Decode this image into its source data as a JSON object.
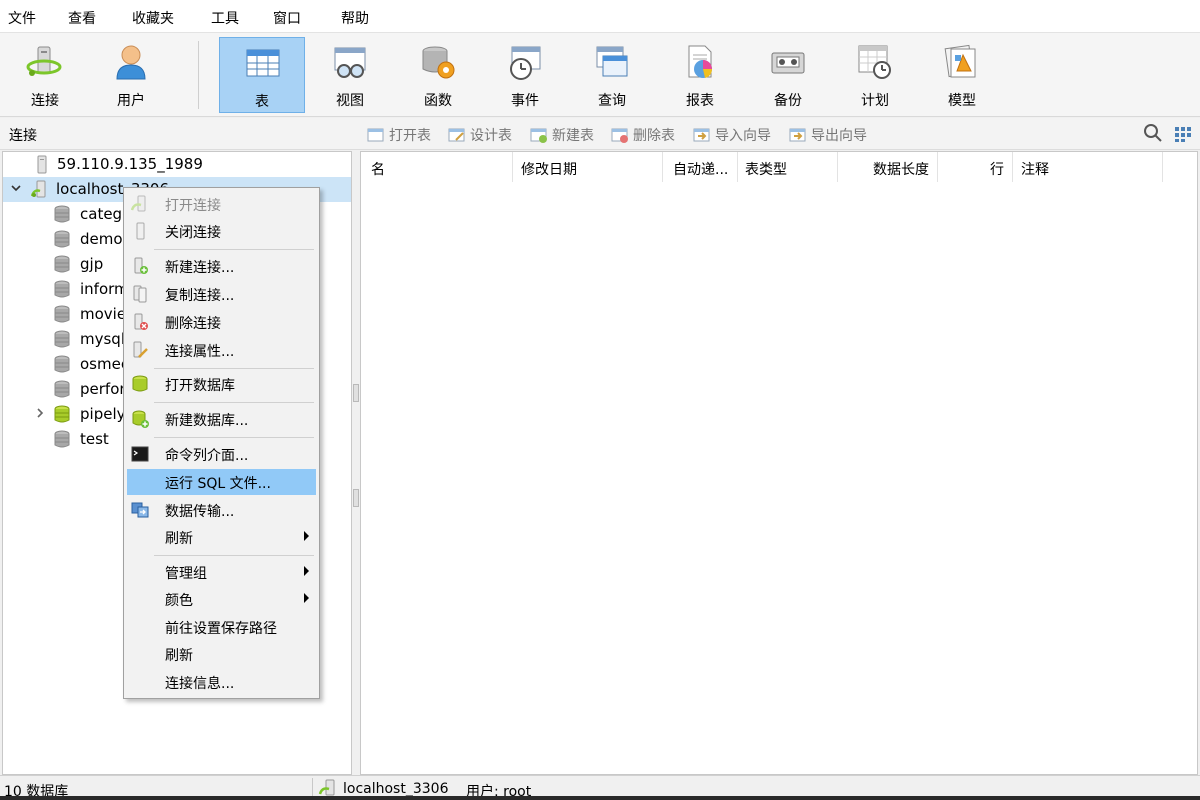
{
  "menubar": {
    "items": [
      "文件",
      "查看",
      "收藏夹",
      "工具",
      "窗口",
      "帮助"
    ]
  },
  "toolbar": {
    "buttons": [
      {
        "label": "连接",
        "icon": "connection-icon"
      },
      {
        "label": "用户",
        "icon": "user-icon"
      },
      {
        "label": "表",
        "icon": "table-icon",
        "active": true
      },
      {
        "label": "视图",
        "icon": "view-icon"
      },
      {
        "label": "函数",
        "icon": "function-icon"
      },
      {
        "label": "事件",
        "icon": "event-icon"
      },
      {
        "label": "查询",
        "icon": "query-icon"
      },
      {
        "label": "报表",
        "icon": "report-icon"
      },
      {
        "label": "备份",
        "icon": "backup-icon"
      },
      {
        "label": "计划",
        "icon": "schedule-icon"
      },
      {
        "label": "模型",
        "icon": "model-icon"
      }
    ]
  },
  "subheader": {
    "title": "连接",
    "object_buttons": [
      "打开表",
      "设计表",
      "新建表",
      "删除表",
      "导入向导",
      "导出向导"
    ]
  },
  "tree": {
    "connections": [
      {
        "label": "59.110.9.135_1989",
        "expanded": false
      },
      {
        "label": "localhost_3306",
        "expanded": true
      }
    ],
    "databases": [
      {
        "label": "catego",
        "open": false
      },
      {
        "label": "demo",
        "open": false
      },
      {
        "label": "gjp",
        "open": false
      },
      {
        "label": "inform",
        "open": false
      },
      {
        "label": "movie",
        "open": false
      },
      {
        "label": "mysql",
        "open": false
      },
      {
        "label": "osmec",
        "open": false
      },
      {
        "label": "perfor",
        "open": false
      },
      {
        "label": "pipely",
        "open": true
      },
      {
        "label": "test",
        "open": false
      }
    ]
  },
  "table_columns": [
    "名",
    "修改日期",
    "自动递...",
    "表类型",
    "数据长度",
    "行",
    "注释"
  ],
  "context_menu": {
    "items": [
      {
        "label": "打开连接",
        "icon": "open-connection-icon",
        "disabled": true
      },
      {
        "label": "关闭连接",
        "icon": "close-connection-icon"
      },
      {
        "label": "新建连接...",
        "icon": "new-connection-icon"
      },
      {
        "label": "复制连接...",
        "icon": "copy-connection-icon"
      },
      {
        "label": "删除连接",
        "icon": "delete-connection-icon"
      },
      {
        "label": "连接属性...",
        "icon": "connection-properties-icon"
      },
      {
        "label": "打开数据库",
        "icon": "open-database-icon"
      },
      {
        "label": "新建数据库...",
        "icon": "new-database-icon"
      },
      {
        "label": "命令列介面...",
        "icon": "console-icon"
      },
      {
        "label": "运行 SQL 文件...",
        "highlighted": true
      },
      {
        "label": "数据传输...",
        "icon": "data-transfer-icon"
      },
      {
        "label": "刷新",
        "submenu": true
      },
      {
        "label": "管理组",
        "submenu": true
      },
      {
        "label": "颜色",
        "submenu": true
      },
      {
        "label": "前往设置保存路径"
      },
      {
        "label": "刷新"
      },
      {
        "label": "连接信息..."
      }
    ]
  },
  "statusbar": {
    "db_count": "10 数据库",
    "connection": "localhost_3306",
    "user": "用户: root"
  },
  "colors": {
    "active_button": "#a8d2f5",
    "highlight": "#91c9f7",
    "db_icon": "#9a9a9a",
    "db_icon_open": "#a8cc2a"
  }
}
